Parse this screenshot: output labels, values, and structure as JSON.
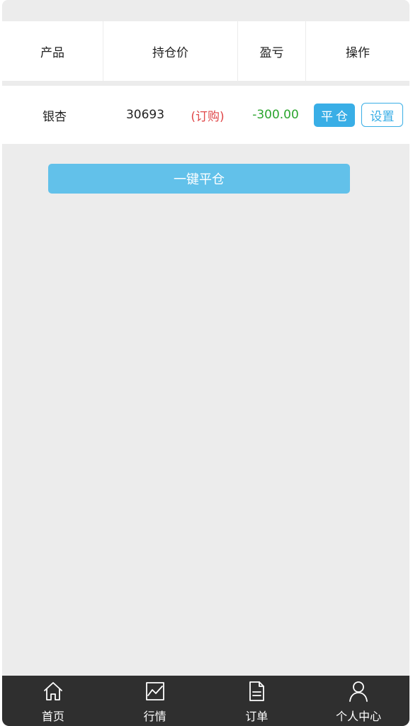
{
  "table": {
    "headers": [
      "产品",
      "持仓价",
      "盈亏",
      "操作"
    ],
    "rows": [
      {
        "product": "银杏",
        "price": "30693",
        "type": "(订购)",
        "pnl": "-300.00",
        "close_label": "平仓",
        "setting_label": "设置"
      }
    ]
  },
  "close_all_label": "一键平仓",
  "tabbar": {
    "items": [
      {
        "label": "首页",
        "icon": "home-icon"
      },
      {
        "label": "行情",
        "icon": "chart-icon"
      },
      {
        "label": "订单",
        "icon": "document-icon"
      },
      {
        "label": "个人中心",
        "icon": "user-icon"
      }
    ]
  },
  "colors": {
    "accent": "#39aee6",
    "close_all_button": "#62c1ea",
    "loss_text": "#2ba52e",
    "order_type_text": "#e0484a",
    "tabbar_bg": "#2f2f2f",
    "page_bg": "#ececec"
  }
}
